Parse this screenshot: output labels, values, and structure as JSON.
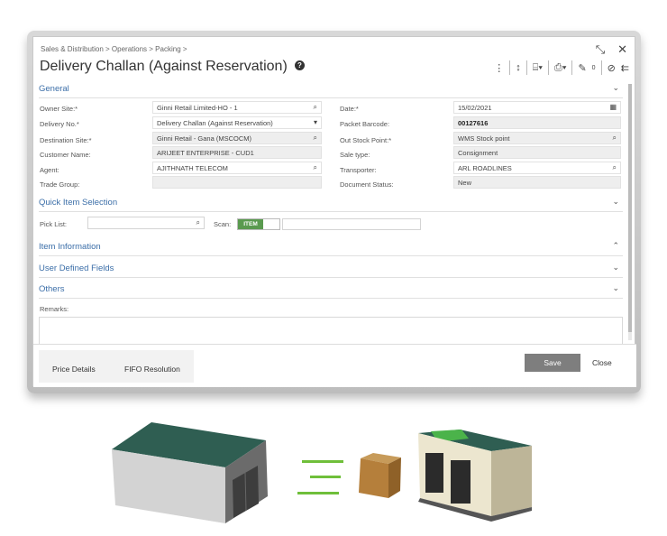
{
  "breadcrumb": "Sales & Distribution > Operations > Packing >",
  "title": "Delivery Challan (Against Reservation)",
  "sections": {
    "general": "General",
    "quick_item": "Quick Item Selection",
    "item_info": "Item Information",
    "udf": "User Defined Fields",
    "others": "Others"
  },
  "fields": {
    "owner_site": {
      "label": "Owner Site:*",
      "value": "Ginni Retail Limited-HO - 1"
    },
    "delivery_no": {
      "label": "Delivery No.*",
      "value": "Delivery Challan (Against Reservation)"
    },
    "destination_site": {
      "label": "Destination Site:*",
      "value": "Ginni Retail - Gana (MSCOCM)"
    },
    "customer_name": {
      "label": "Customer Name:",
      "value": "ARIJEET ENTERPRISE - CUD1"
    },
    "agent": {
      "label": "Agent:",
      "value": "AJITHNATH TELECOM"
    },
    "trade_group": {
      "label": "Trade Group:",
      "value": ""
    },
    "date": {
      "label": "Date:*",
      "value": "15/02/2021"
    },
    "packet_barcode": {
      "label": "Packet Barcode:",
      "value": "00127616"
    },
    "out_stock_point": {
      "label": "Out Stock Point:*",
      "value": "WMS Stock point"
    },
    "sale_type": {
      "label": "Sale type:",
      "value": "Consignment"
    },
    "transporter": {
      "label": "Transporter:",
      "value": "ARL ROADLINES"
    },
    "document_status": {
      "label": "Document Status:",
      "value": "New"
    }
  },
  "quick": {
    "pick_list_label": "Pick List:",
    "scan_label": "Scan:",
    "toggle_label": "ITEM"
  },
  "remarks_label": "Remarks:",
  "footer": {
    "price_details": "Price Details",
    "fifo_resolution": "FIFO Resolution",
    "save": "Save",
    "close": "Close"
  },
  "toolbar": {
    "attachment_count": "0"
  },
  "colors": {
    "section_label": "#3b6ea8",
    "toggle_on": "#5a9a4f",
    "save_button": "#7e7e7e"
  }
}
